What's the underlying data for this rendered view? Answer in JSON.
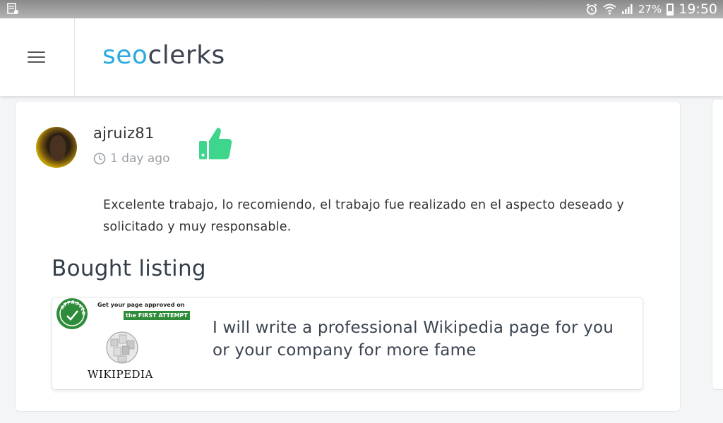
{
  "statusbar": {
    "battery_percent": "27%",
    "time": "19:50"
  },
  "header": {
    "logo_part1": "seo",
    "logo_part2": "clerks"
  },
  "review": {
    "username": "ajruiz81",
    "time_ago": "1 day ago",
    "comment": "Excelente trabajo, lo recomiendo, el trabajo fue realizado en el aspecto deseado y solicitado y muy responsable."
  },
  "bought_listing": {
    "section_title": "Bought listing",
    "thumbnail": {
      "badge_text": "APPROVED",
      "promo_line1": "Get your page approved on",
      "promo_line2": "the FIRST ATTEMPT",
      "wordmark": "WIKIPEDIA"
    },
    "title": "I will write a professional Wikipedia page for you or your company for more fame"
  },
  "colors": {
    "brand_blue": "#29abe2",
    "brand_dark": "#3b4450",
    "thumb_green": "#3dd68c"
  }
}
